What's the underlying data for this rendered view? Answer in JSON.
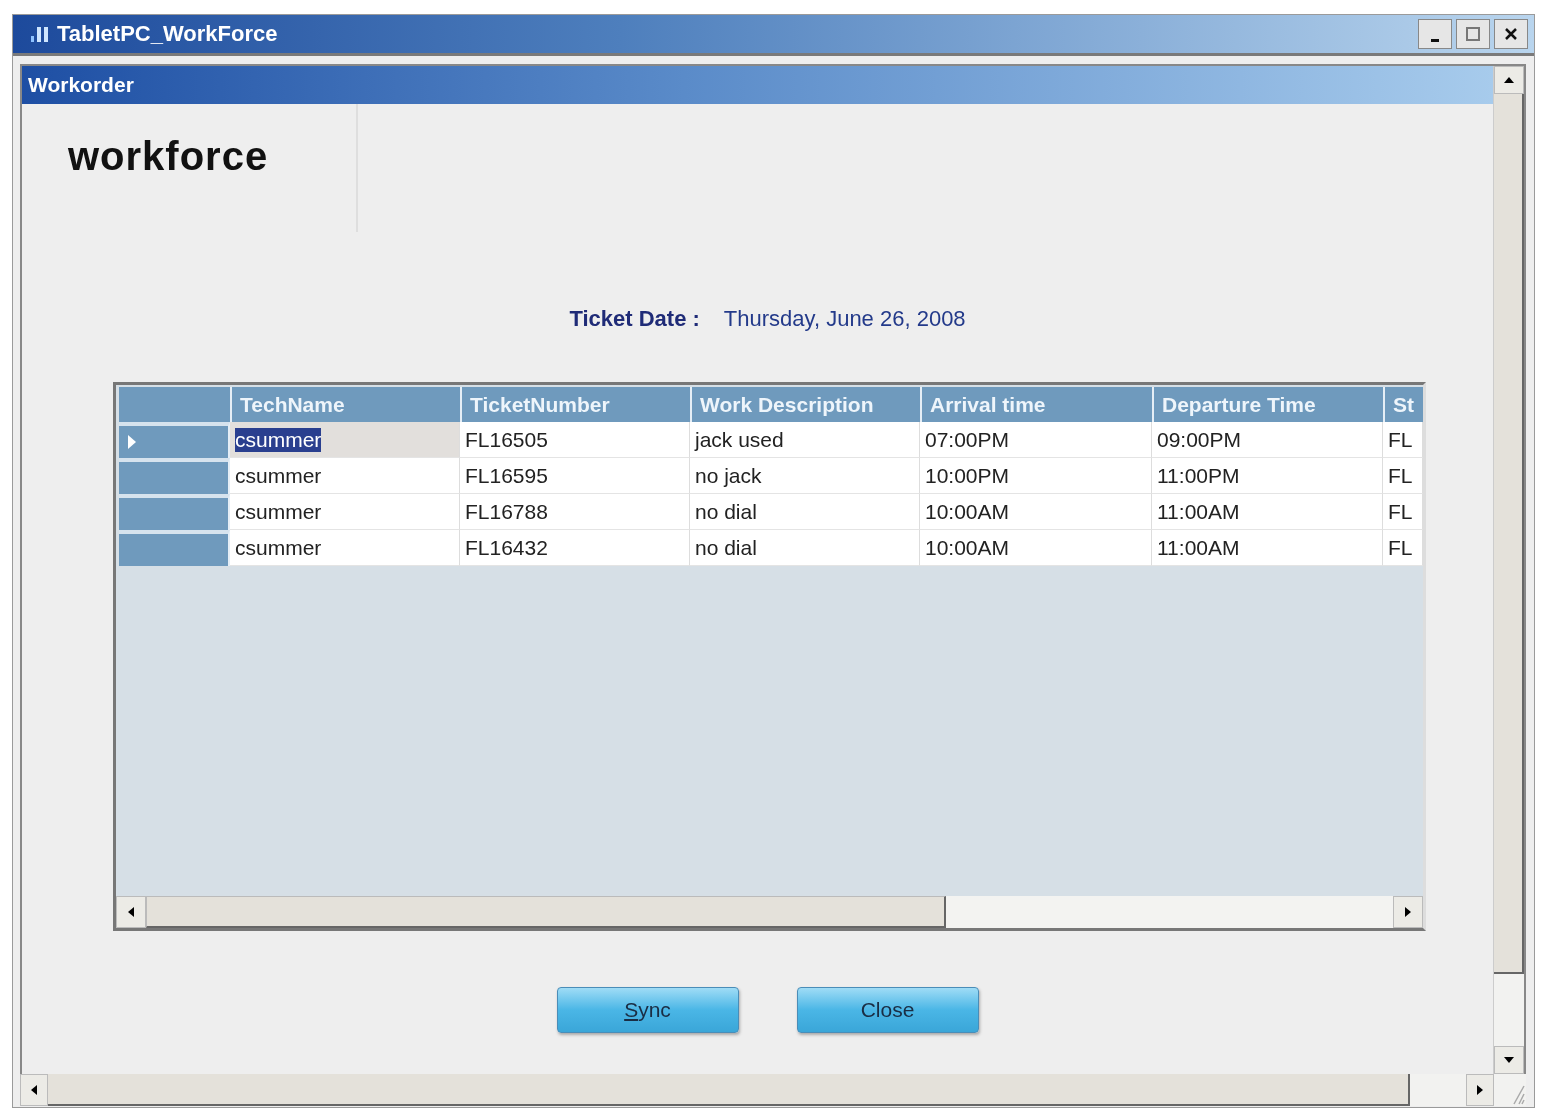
{
  "window": {
    "title": "TabletPC_WorkForce"
  },
  "form": {
    "title": "Workorder"
  },
  "logo": "workforce",
  "ticket_date": {
    "label": "Ticket Date :",
    "value": "Thursday, June 26, 2008"
  },
  "table": {
    "columns": [
      "TechName",
      "TicketNumber",
      "Work Description",
      "Arrival time",
      "Departure Time",
      "St"
    ],
    "rows": [
      {
        "selected": true,
        "cells": [
          "csummer",
          "FL16505",
          "jack used",
          "07:00PM",
          "09:00PM",
          "FL"
        ]
      },
      {
        "selected": false,
        "cells": [
          "csummer",
          "FL16595",
          "no jack",
          "10:00PM",
          "11:00PM",
          "FL"
        ]
      },
      {
        "selected": false,
        "cells": [
          "csummer",
          "FL16788",
          "no dial",
          "10:00AM",
          "11:00AM",
          "FL"
        ]
      },
      {
        "selected": false,
        "cells": [
          "csummer",
          "FL16432",
          "no dial",
          "10:00AM",
          "11:00AM",
          "FL"
        ]
      }
    ]
  },
  "buttons": [
    "Sync",
    "Close"
  ]
}
